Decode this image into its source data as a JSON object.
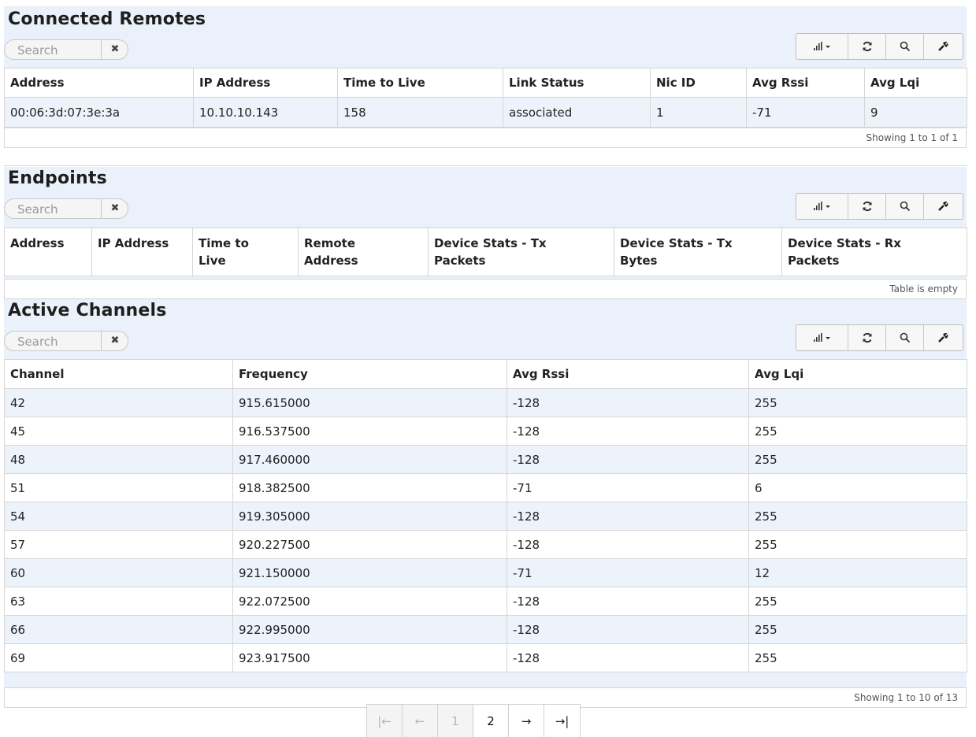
{
  "search_placeholder": "Search",
  "clear_icon_glyph": "✖",
  "remotes": {
    "title": "Connected Remotes",
    "columns": [
      "Address",
      "IP Address",
      "Time to Live",
      "Link Status",
      "Nic ID",
      "Avg Rssi",
      "Avg Lqi"
    ],
    "rows": [
      [
        "00:06:3d:07:3e:3a",
        "10.10.10.143",
        "158",
        "associated",
        "1",
        "-71",
        "9"
      ]
    ],
    "footer": "Showing 1 to 1 of 1"
  },
  "endpoints": {
    "title": "Endpoints",
    "columns": [
      [
        "Address",
        ""
      ],
      [
        "IP Address",
        ""
      ],
      [
        "Time to",
        "Live"
      ],
      [
        "Remote",
        "Address"
      ],
      [
        "Device Stats - Tx",
        "Packets"
      ],
      [
        "Device Stats - Tx",
        "Bytes"
      ],
      [
        "Device Stats - Rx",
        "Packets"
      ]
    ],
    "footer": "Table is empty"
  },
  "channels": {
    "title": "Active Channels",
    "columns": [
      "Channel",
      "Frequency",
      "Avg Rssi",
      "Avg Lqi"
    ],
    "rows": [
      [
        "42",
        "915.615000",
        "-128",
        "255"
      ],
      [
        "45",
        "916.537500",
        "-128",
        "255"
      ],
      [
        "48",
        "917.460000",
        "-128",
        "255"
      ],
      [
        "51",
        "918.382500",
        "-71",
        "6"
      ],
      [
        "54",
        "919.305000",
        "-128",
        "255"
      ],
      [
        "57",
        "920.227500",
        "-128",
        "255"
      ],
      [
        "60",
        "921.150000",
        "-71",
        "12"
      ],
      [
        "63",
        "922.072500",
        "-128",
        "255"
      ],
      [
        "66",
        "922.995000",
        "-128",
        "255"
      ],
      [
        "69",
        "923.917500",
        "-128",
        "255"
      ]
    ],
    "footer": "Showing 1 to 10 of 13"
  },
  "pagination": {
    "first": "|←",
    "prev": "←",
    "page1": "1",
    "page2": "2",
    "next": "→",
    "last": "→|",
    "current_page": 2
  },
  "icons": {
    "columns": "columns-chart-icon",
    "refresh": "refresh-icon",
    "search": "magnifier-icon",
    "wrench": "wrench-icon",
    "clear": "clear-icon"
  }
}
